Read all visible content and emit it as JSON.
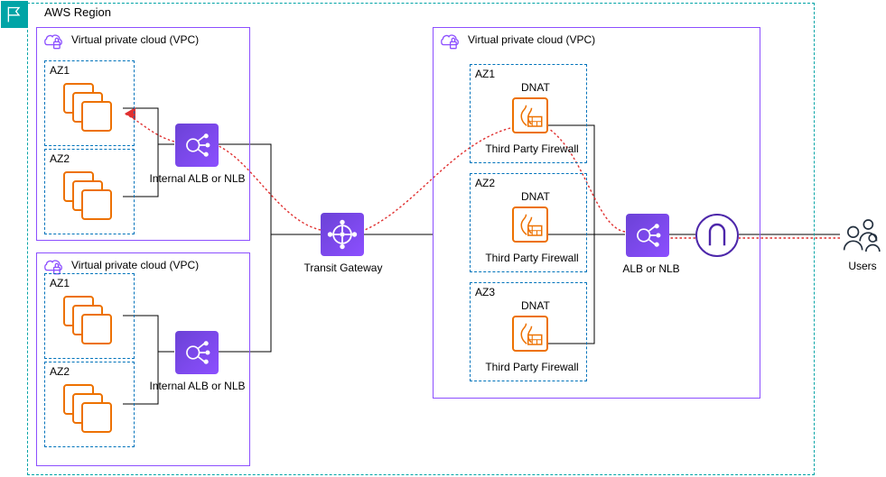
{
  "region_label": "AWS Region",
  "vpc_label": "Virtual private cloud (VPC)",
  "vpc1": {
    "az1_label": "AZ1",
    "az2_label": "AZ2",
    "lb_label": "Internal ALB or NLB"
  },
  "vpc2": {
    "az1_label": "AZ1",
    "az2_label": "AZ2",
    "lb_label": "Internal ALB or NLB"
  },
  "tgw_label": "Transit Gateway",
  "vpc3": {
    "az1_label": "AZ1",
    "az2_label": "AZ2",
    "az3_label": "AZ3",
    "dnat_label": "DNAT",
    "fw_label": "Third Party Firewall",
    "lb_label": "ALB or NLB"
  },
  "users_label": "Users",
  "colors": {
    "aws_teal": "#00A4A6",
    "aws_purple": "#8C4FFF",
    "aws_orange": "#ED7100",
    "flow_red": "#E03030"
  }
}
